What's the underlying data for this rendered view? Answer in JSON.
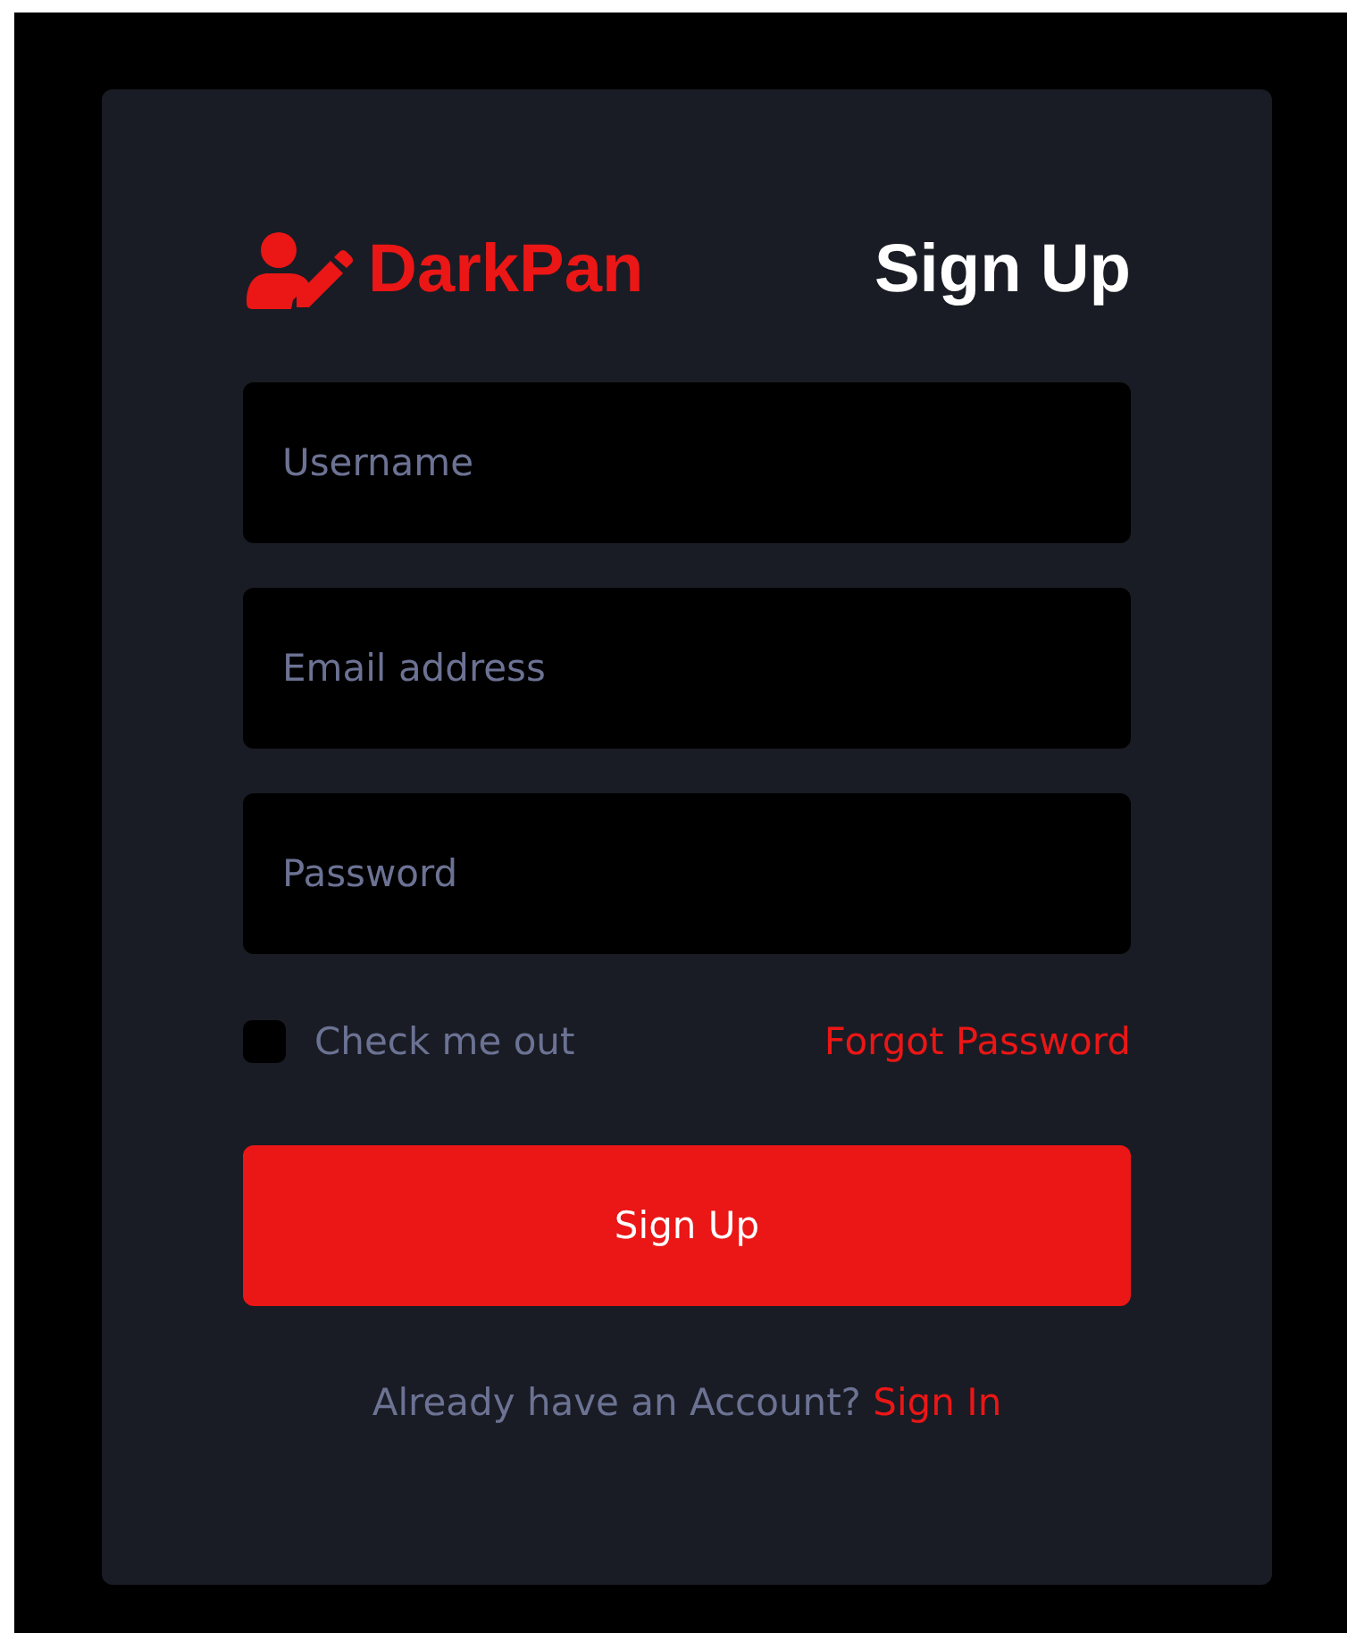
{
  "brand": {
    "name": "DarkPan"
  },
  "title": "Sign Up",
  "fields": [
    {
      "placeholder": "Username"
    },
    {
      "placeholder": "Email address"
    },
    {
      "placeholder": "Password"
    }
  ],
  "remember": {
    "label": "Check me out",
    "checked": false
  },
  "forgot_link": "Forgot Password",
  "submit_button": "Sign Up",
  "footer": {
    "text": "Already have an Account?",
    "link": "Sign In"
  }
}
